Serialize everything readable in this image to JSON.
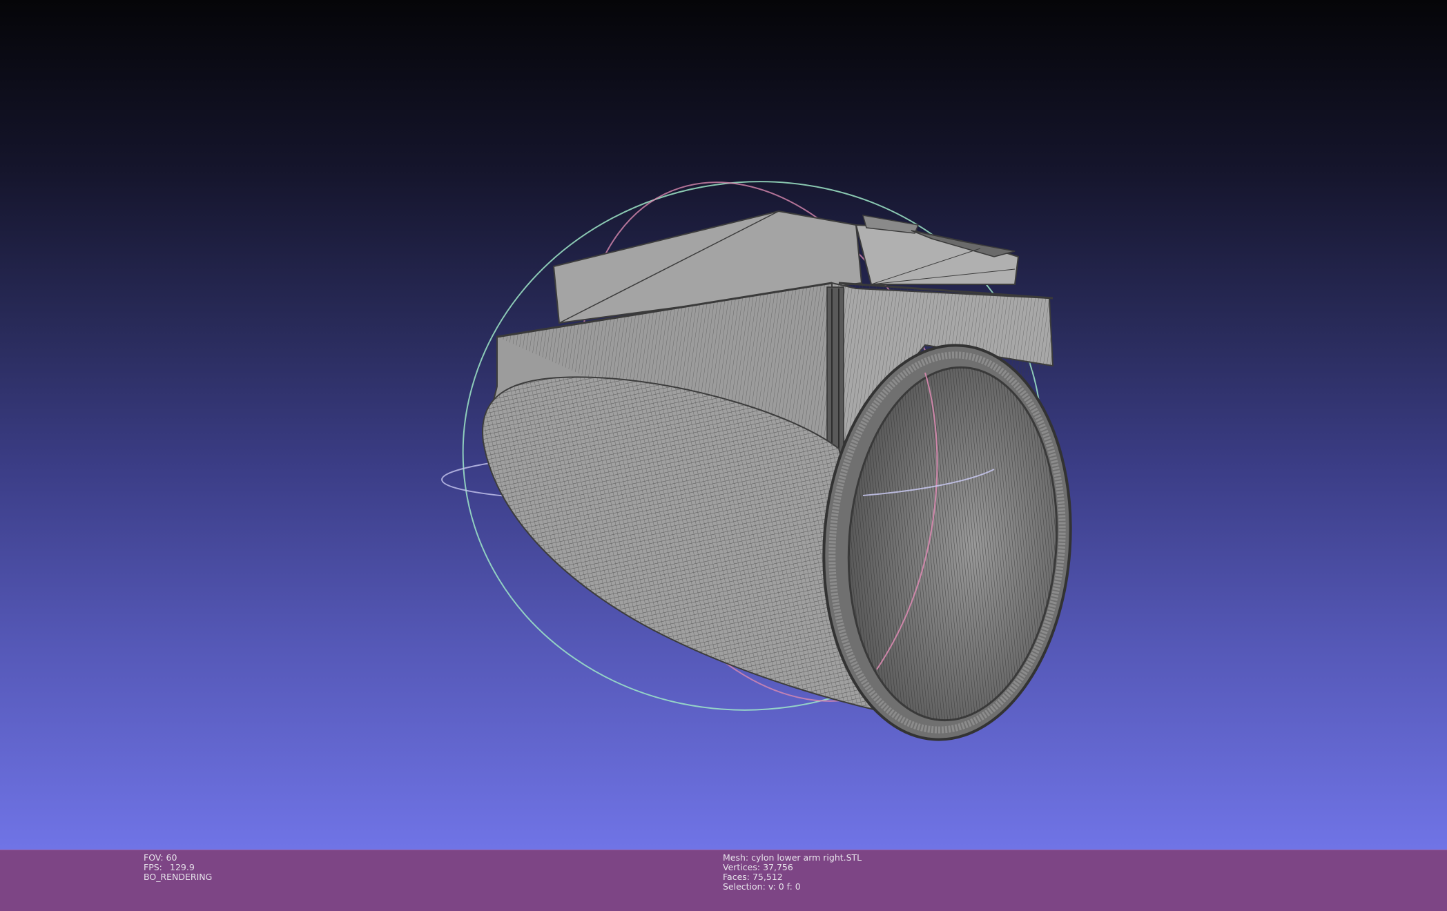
{
  "viewport": {
    "model": "cylon lower arm right.STL",
    "trackball_colors": {
      "x": "#d98ab0",
      "y": "#9fe8c8",
      "z": "#c8c8f0"
    }
  },
  "status_left": {
    "fov_label": "FOV:",
    "fov_value": "60",
    "fps_label": "FPS:",
    "fps_value": "129.9",
    "render_mode": "BO_RENDERING"
  },
  "status_mesh": {
    "mesh_label": "Mesh:",
    "mesh_value": "cylon lower arm right.STL",
    "vertices_label": "Vertices:",
    "vertices_value": "37,756",
    "faces_label": "Faces:",
    "faces_value": "75,512",
    "selection_label": "Selection:",
    "selection_value": "v: 0 f: 0"
  },
  "colors": {
    "statusbar": "#7d4585",
    "mesh_fill": "#a0a0a0",
    "wire": "#3c3c3c"
  }
}
